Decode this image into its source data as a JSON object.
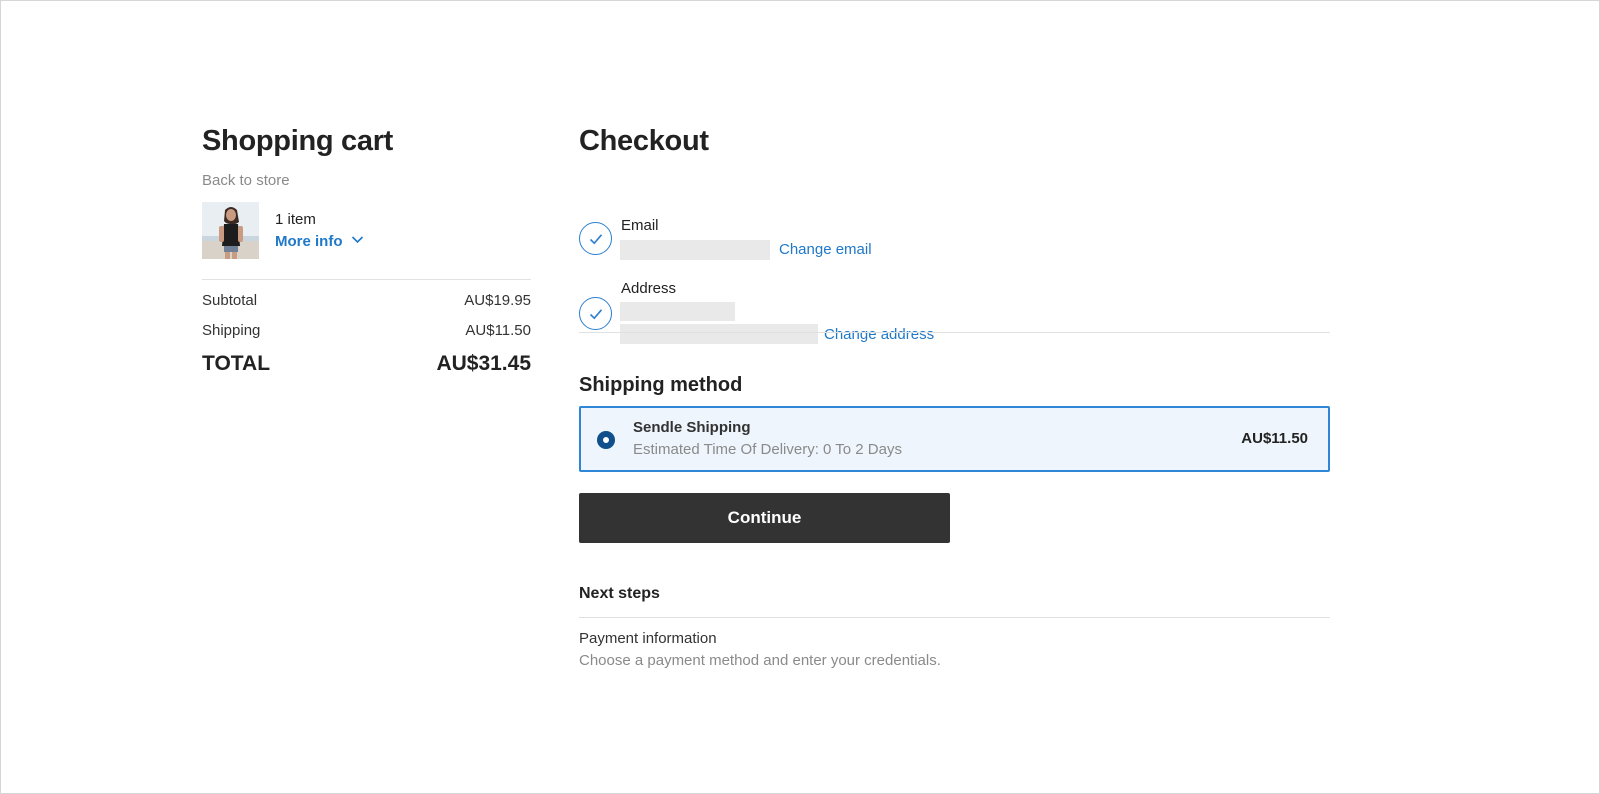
{
  "cart": {
    "title": "Shopping cart",
    "back_link": "Back to store",
    "item_count": "1 item",
    "more_info": "More info",
    "subtotal_label": "Subtotal",
    "subtotal_value": "AU$19.95",
    "shipping_label": "Shipping",
    "shipping_value": "AU$11.50",
    "total_label": "TOTAL",
    "total_value": "AU$31.45"
  },
  "checkout": {
    "title": "Checkout",
    "email": {
      "label": "Email",
      "change_link": "Change email"
    },
    "address": {
      "label": "Address",
      "change_link": "Change address"
    },
    "shipping_method": {
      "heading": "Shipping method",
      "option": {
        "name": "Sendle Shipping",
        "description": "Estimated Time Of Delivery: 0 To 2 Days",
        "price": "AU$11.50",
        "selected": true
      }
    },
    "continue_label": "Continue",
    "next_steps": {
      "heading": "Next steps",
      "items": [
        {
          "title": "Payment information",
          "description": "Choose a payment method and enter your credentials."
        }
      ]
    }
  },
  "colors": {
    "link": "#1f78c8",
    "selected_border": "#2f86d6",
    "selected_bg": "#eef5fc",
    "radio": "#0e4f8c",
    "button_bg": "#333333"
  },
  "icons": {
    "step_complete": "check-circle-icon",
    "expand": "chevron-down-icon",
    "product": "product-thumbnail"
  }
}
